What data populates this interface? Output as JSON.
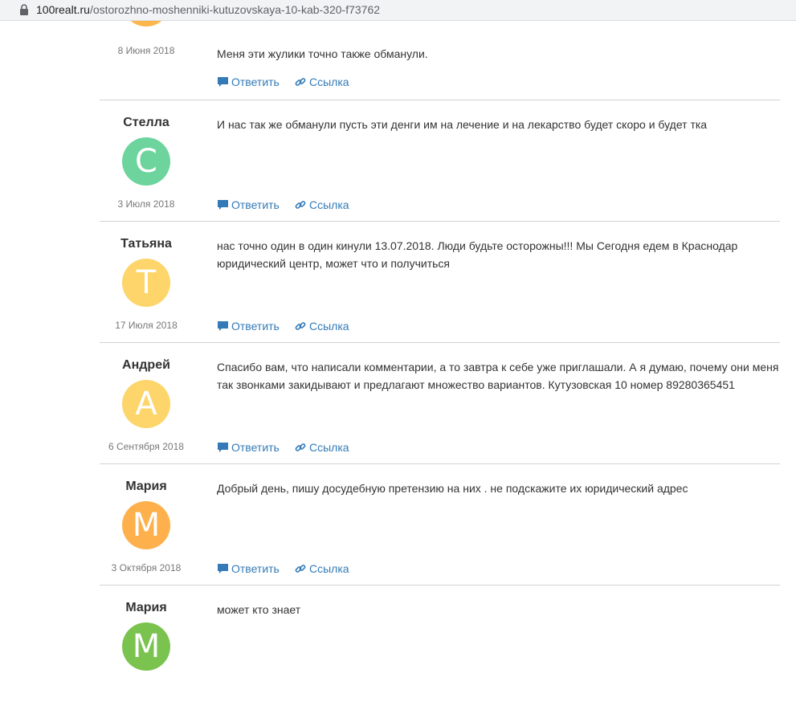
{
  "browser": {
    "url_domain": "100realt.ru",
    "url_path": "/ostorozhno-moshenniki-kutuzovskaya-10-kab-320-f73762"
  },
  "actions": {
    "reply_label": "Ответить",
    "link_label": "Ссылка"
  },
  "comments": [
    {
      "author": "",
      "initial": "",
      "avatar_color": "#fdb64b",
      "date": "8 Июня 2018",
      "text": "Меня эти жулики точно также обманули."
    },
    {
      "author": "Стелла",
      "initial": "С",
      "avatar_color": "#6cd49c",
      "date": "3 Июля 2018",
      "text": "И нас так же обманули пусть эти денги им на лечение и на лекарство будет скоро и будет тка"
    },
    {
      "author": "Татьяна",
      "initial": "Т",
      "avatar_color": "#fdd56b",
      "date": "17 Июля 2018",
      "text": "нас точно один в один кинули 13.07.2018. Люди будьте осторожны!!! Мы Сегодня едем в Краснодар юридический центр, может что и получиться"
    },
    {
      "author": "Андрей",
      "initial": "А",
      "avatar_color": "#fdd56b",
      "date": "6 Сентября 2018",
      "text": "Спасибо вам, что написали комментарии, а то завтра к себе уже приглашали. А я думаю, почему они меня так звонками закидывают и предлагают множество вариантов. Кутузовская 10 номер 89280365451"
    },
    {
      "author": "Мария",
      "initial": "М",
      "avatar_color": "#fdb04b",
      "date": "3 Октября 2018",
      "text": "Добрый день, пишу досудебную претензию на них . не подскажите их юридический адрес"
    },
    {
      "author": "Мария",
      "initial": "М",
      "avatar_color": "#7ac34f",
      "date": "",
      "text": "может кто знает"
    }
  ]
}
